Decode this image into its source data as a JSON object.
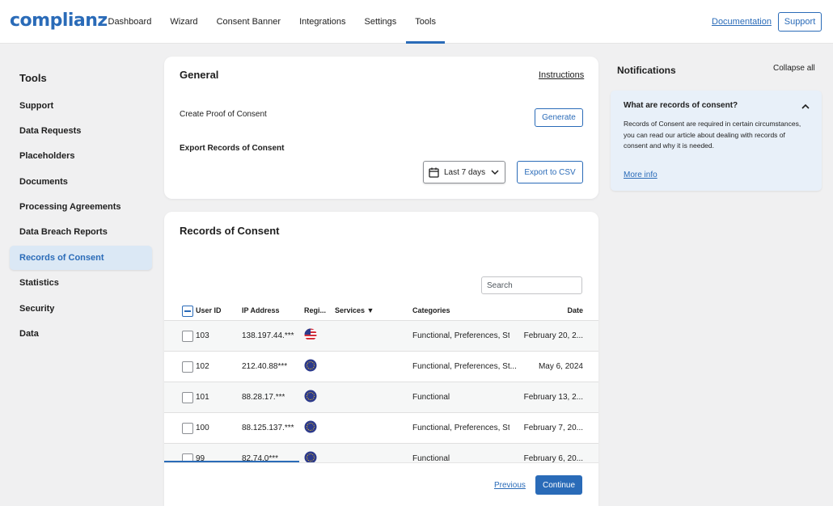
{
  "header": {
    "logo": "complianz",
    "nav": [
      {
        "label": "Dashboard",
        "active": false
      },
      {
        "label": "Wizard",
        "active": false
      },
      {
        "label": "Consent Banner",
        "active": false
      },
      {
        "label": "Integrations",
        "active": false
      },
      {
        "label": "Settings",
        "active": false
      },
      {
        "label": "Tools",
        "active": true
      }
    ],
    "documentation_label": "Documentation",
    "support_label": "Support"
  },
  "sidebar": {
    "title": "Tools",
    "items": [
      {
        "label": "Support",
        "active": false
      },
      {
        "label": "Data Requests",
        "active": false
      },
      {
        "label": "Placeholders",
        "active": false
      },
      {
        "label": "Documents",
        "active": false
      },
      {
        "label": "Processing Agreements",
        "active": false
      },
      {
        "label": "Data Breach Reports",
        "active": false
      },
      {
        "label": "Records of Consent",
        "active": true
      },
      {
        "label": "Statistics",
        "active": false
      },
      {
        "label": "Security",
        "active": false
      },
      {
        "label": "Data",
        "active": false
      }
    ]
  },
  "general": {
    "title": "General",
    "instructions_label": "Instructions",
    "proof_label": "Create Proof of Consent",
    "generate_label": "Generate",
    "export_label": "Export Records of Consent",
    "date_range": "Last 7 days",
    "export_csv_label": "Export to CSV"
  },
  "records": {
    "title": "Records of Consent",
    "search_placeholder": "Search",
    "columns": {
      "user_id": "User ID",
      "ip": "IP Address",
      "region": "Regi...",
      "services": "Services ▼",
      "categories": "Categories",
      "date": "Date"
    },
    "rows": [
      {
        "user_id": "103",
        "ip": "138.197.44.***",
        "region": "us-flag-icon",
        "services": "",
        "categories": "Functional, Preferences, St...",
        "date": "February 20, 2..."
      },
      {
        "user_id": "102",
        "ip": "212.40.88***",
        "region": "eu-flag-icon",
        "services": "",
        "categories": "Functional, Preferences, St...",
        "date": "May 6, 2024"
      },
      {
        "user_id": "101",
        "ip": "88.28.17.***",
        "region": "eu-flag-icon",
        "services": "",
        "categories": "Functional",
        "date": "February 13, 2..."
      },
      {
        "user_id": "100",
        "ip": "88.125.137.***",
        "region": "eu-flag-icon",
        "services": "",
        "categories": "Functional, Preferences, St...",
        "date": "February 7, 20..."
      },
      {
        "user_id": "99",
        "ip": "82.74.0***",
        "region": "eu-flag-icon",
        "services": "",
        "categories": "Functional",
        "date": "February 6, 20..."
      }
    ],
    "previous_label": "Previous",
    "continue_label": "Continue"
  },
  "notifications": {
    "title": "Notifications",
    "collapse_all_label": "Collapse all",
    "item": {
      "heading": "What are records of consent?",
      "body": "Records of Consent are required in certain circumstances, you can read our article about dealing with records of consent and why it is needed.",
      "more_label": "More info"
    }
  },
  "colors": {
    "accent": "#2a6bb8",
    "background": "#f0f0f1",
    "active_sidebar": "#dbe8f5",
    "notification_bg": "#e8f0f9"
  }
}
